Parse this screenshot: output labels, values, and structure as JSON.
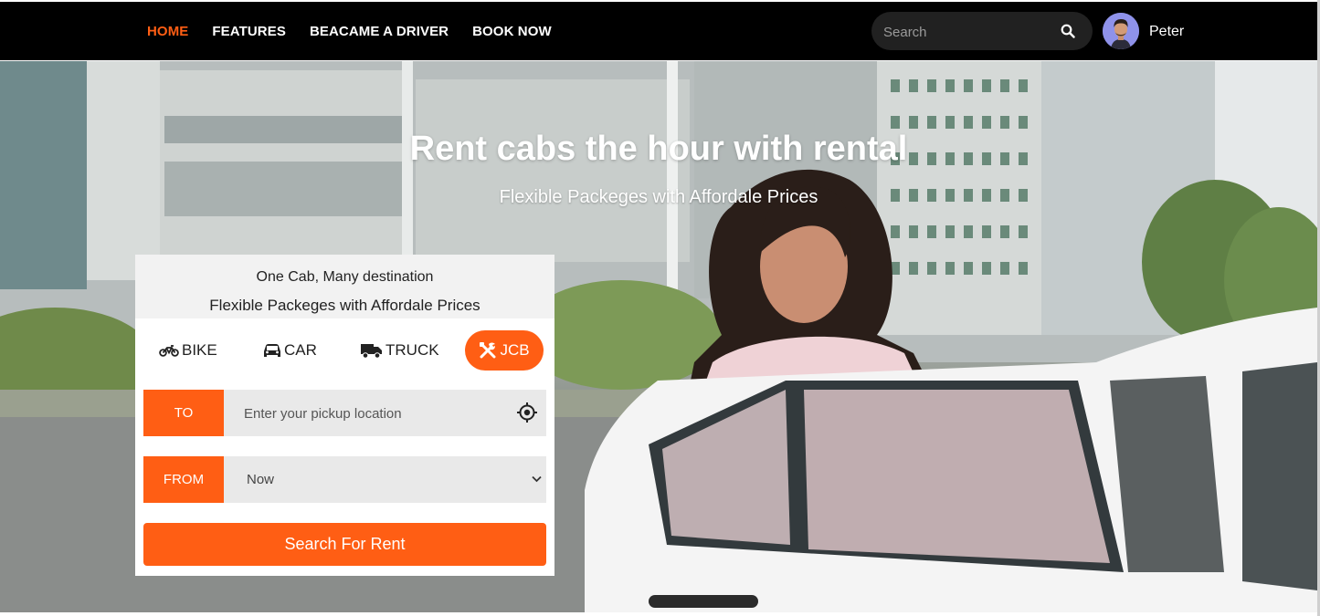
{
  "nav": {
    "items": [
      {
        "label": "HOME",
        "active": true
      },
      {
        "label": "FEATURES",
        "active": false
      },
      {
        "label": "BEACAME A DRIVER",
        "active": false
      },
      {
        "label": "BOOK NOW",
        "active": false
      }
    ]
  },
  "search": {
    "placeholder": "Search",
    "icon": "search-icon"
  },
  "user": {
    "name": "Peter",
    "avatar_icon": "user-avatar"
  },
  "hero": {
    "title": "Rent cabs the hour with rental",
    "subtitle": "Flexible Packeges with Affordale Prices"
  },
  "booking": {
    "heading": "One Cab, Many destination",
    "subheading": "Flexible Packeges with Affordale Prices",
    "vehicles": [
      {
        "label": "BIKE",
        "icon": "motorcycle-icon",
        "active": false
      },
      {
        "label": "CAR",
        "icon": "car-icon",
        "active": false
      },
      {
        "label": "TRUCK",
        "icon": "truck-icon",
        "active": false
      },
      {
        "label": "JCB",
        "icon": "tools-icon",
        "active": true
      }
    ],
    "to_label": "TO",
    "to_placeholder": "Enter your pickup location",
    "locate_icon": "crosshair-icon",
    "from_label": "FROM",
    "from_value": "Now",
    "submit_label": "Search For Rent"
  },
  "colors": {
    "accent": "#ff5e14",
    "topbar": "#000000",
    "field_bg": "#e9e9e9"
  }
}
